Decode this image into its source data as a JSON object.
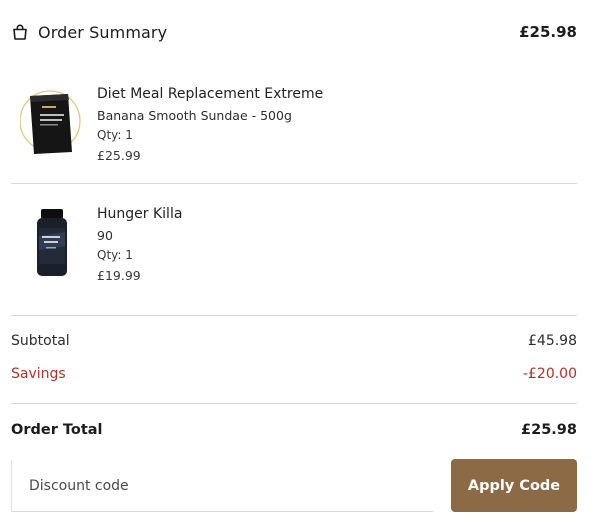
{
  "header": {
    "title": "Order Summary",
    "total": "£25.98",
    "icon": "shopping-bag-icon"
  },
  "items": [
    {
      "name": "Diet Meal Replacement Extreme",
      "variant": "Banana Smooth Sundae  -  500g",
      "qty": "Qty: 1",
      "price": "£25.99",
      "image": "protein-pouch-image"
    },
    {
      "name": "Hunger Killa",
      "variant": "90",
      "qty": "Qty: 1",
      "price": "£19.99",
      "image": "supplement-bottle-image"
    }
  ],
  "summary": {
    "subtotal_label": "Subtotal",
    "subtotal_value": "£45.98",
    "savings_label": "Savings",
    "savings_value": "-£20.00",
    "total_label": "Order Total",
    "total_value": "£25.98"
  },
  "discount": {
    "placeholder": "Discount code",
    "button_label": "Apply Code"
  },
  "colors": {
    "accent_button": "#8c6a45",
    "savings": "#b0312c",
    "divider": "#d8d8d8"
  }
}
